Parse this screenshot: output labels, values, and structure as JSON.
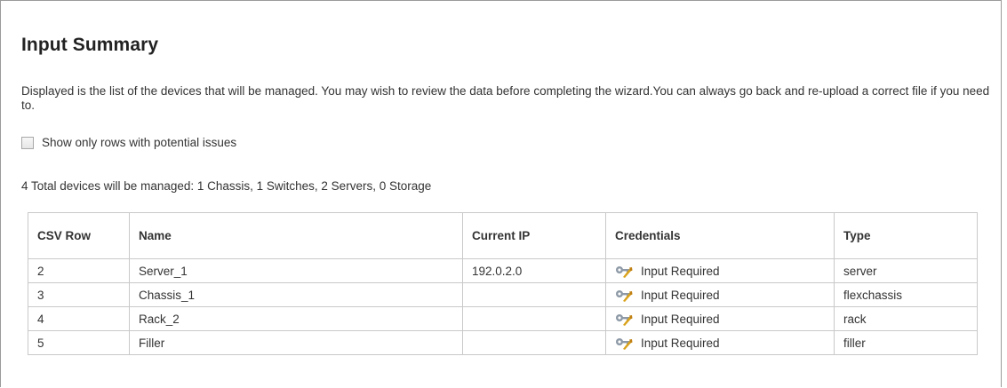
{
  "page": {
    "title": "Input Summary",
    "description": "Displayed is the list of the devices that will be managed. You may wish to review the data before completing the wizard.You can always go back and re-upload a correct file if you need to."
  },
  "filter": {
    "label": "Show only rows with potential issues",
    "checked": false
  },
  "summary": "4 Total devices will be managed: 1 Chassis, 1 Switches, 2 Servers, 0 Storage",
  "table": {
    "headers": {
      "csv_row": "CSV Row",
      "name": "Name",
      "current_ip": "Current IP",
      "credentials": "Credentials",
      "type": "Type"
    },
    "rows": [
      {
        "csv_row": "2",
        "name": "Server_1",
        "current_ip": "192.0.2.0",
        "credentials": "Input Required",
        "credentials_icon": "key-wrench-icon",
        "type": "server"
      },
      {
        "csv_row": "3",
        "name": "Chassis_1",
        "current_ip": "",
        "credentials": "Input Required",
        "credentials_icon": "key-wrench-icon",
        "type": "flexchassis"
      },
      {
        "csv_row": "4",
        "name": "Rack_2",
        "current_ip": "",
        "credentials": "Input Required",
        "credentials_icon": "key-wrench-icon",
        "type": "rack"
      },
      {
        "csv_row": "5",
        "name": "Filler",
        "current_ip": "",
        "credentials": "Input Required",
        "credentials_icon": "key-wrench-icon",
        "type": "filler"
      }
    ]
  },
  "colors": {
    "border": "#c9c9c9",
    "text": "#333333",
    "title": "#222222",
    "icon_gold": "#d9a21b",
    "icon_gray": "#8d99a6"
  }
}
